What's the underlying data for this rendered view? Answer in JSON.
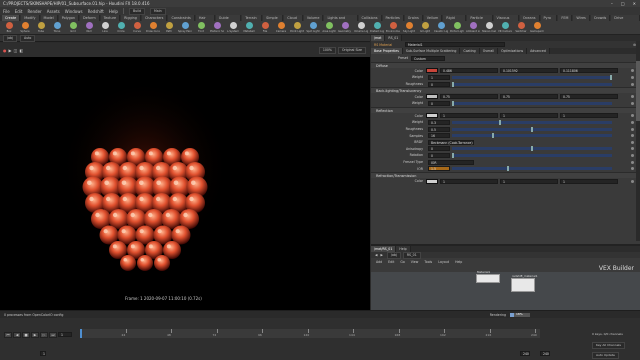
{
  "window": {
    "title": "C:/PROJECTS/SKINSHAPE/HIP/01_Subsurface.01.hip - Houdini FX 18.0.416",
    "buttons": [
      "–",
      "□",
      "✕"
    ]
  },
  "menu": [
    "File",
    "Edit",
    "Render",
    "Assets",
    "Windows",
    "Redshift",
    "Help",
    "Build",
    "Main"
  ],
  "shelf_tabs": [
    "Create",
    "Modify",
    "Model",
    "Polygon",
    "Deform",
    "Texture",
    "Rigging",
    "Characters",
    "Constraints",
    "Hair Utils",
    "Guide Process",
    "Terrain FX",
    "Simple FX",
    "Cloud FX",
    "Volume",
    "Lights and Cameras",
    "Collisions",
    "Particles",
    "Grains",
    "Vellum",
    "Rigid Bodies",
    "Particle Fluids",
    "Viscous Fluids",
    "Oceans",
    "Pyro FX",
    "FEM",
    "Wires",
    "Crowds",
    "Drive Simulation"
  ],
  "shelf_tools": [
    "Box",
    "Sphere",
    "Tube",
    "Torus",
    "Grid",
    "Null",
    "Line",
    "Circle",
    "Curve",
    "Draw Curve",
    "Path",
    "Spray Paint",
    "Font",
    "Platonic Solids",
    "L-System",
    "Metaball",
    "File",
    "Camera",
    "Point Light",
    "Spot Light",
    "Area Light",
    "Geometry Light",
    "Volume Light",
    "Distant Light",
    "Environment Light",
    "Sky Light",
    "GI Light",
    "Caustic Light",
    "Portal Light",
    "Ambient Light",
    "Stereo Camera",
    "VR Camera",
    "Switcher",
    "Gamepad Camera"
  ],
  "viewport": {
    "toolbar": [
      "/obj",
      "Auto"
    ],
    "zoom": "100%",
    "display": "Original Size",
    "frame_info": "Frame: 1   2020-09-07  11:00:10  (0.72s)"
  },
  "params": {
    "tabs": [
      "/mat",
      "RS_01"
    ],
    "node_type": "RS Material",
    "node_name": "Material1",
    "subtabs": [
      "Base Properties",
      "Sub-Surface Multiple Scattering",
      "Coating",
      "Overall",
      "Optimizations",
      "Advanced"
    ],
    "preset": {
      "label": "Preset",
      "value": "Custom"
    },
    "sections": [
      {
        "title": "Diffuse",
        "rows": [
          {
            "label": "Color",
            "swatch": "#c8453a",
            "values": [
              "0.486",
              "0.101592",
              "0.111806"
            ]
          },
          {
            "label": "Weight",
            "values": [
              "1"
            ],
            "slider": 1.0
          },
          {
            "label": "Roughness",
            "values": [
              "0"
            ],
            "slider": 0.0
          }
        ]
      },
      {
        "title": "Back-lighting/Translucency",
        "rows": [
          {
            "label": "Color",
            "swatch": "#bfbfbf",
            "values": [
              "0.75",
              "0.75",
              "0.75"
            ]
          },
          {
            "label": "Weight",
            "values": [
              "0"
            ],
            "slider": 0.0
          }
        ]
      },
      {
        "title": "Reflection",
        "rows": [
          {
            "label": "Color",
            "swatch": "#d0d0d0",
            "values": [
              "1",
              "1",
              "1"
            ]
          },
          {
            "label": "Weight",
            "values": [
              "0.3"
            ],
            "slider": 0.3
          },
          {
            "label": "Roughness",
            "values": [
              "0.5"
            ],
            "slider": 0.5
          },
          {
            "label": "Samples",
            "values": [
              "16"
            ],
            "slider": 0.25
          },
          {
            "label": "BRDF",
            "values": [
              "Beckmann (Cook-Torrance)"
            ]
          },
          {
            "label": "Anisotropy",
            "values": [
              "0"
            ],
            "slider": 0.5
          },
          {
            "label": "Rotation",
            "values": [
              "0"
            ],
            "slider": 0.0
          },
          {
            "label": "Fresnel Type",
            "values": [
              "IOR"
            ]
          },
          {
            "label": "IOR",
            "values": [
              "1.5"
            ],
            "slider": 0.35
          }
        ]
      },
      {
        "title": "Refraction/Transmission",
        "rows": [
          {
            "label": "Color",
            "swatch": "#d0d0d0",
            "values": [
              "1",
              "1",
              "1"
            ]
          }
        ]
      }
    ]
  },
  "network": {
    "tabs": [
      "/mat/RS_01",
      "Help"
    ],
    "menu": [
      "Add",
      "Edit",
      "Go",
      "View",
      "Tools",
      "Layout",
      "Help"
    ],
    "path": [
      "/obj",
      "RS_01"
    ],
    "builder": "VEX Builder",
    "nodes": [
      "Material1",
      "redshift_material1"
    ]
  },
  "timeline": {
    "status": "0 processes from OpenColorIO config",
    "rendering": "Rendering",
    "progress": "18%",
    "frame": "1",
    "start": "1",
    "end": "240",
    "end2": "240",
    "ticks": [
      "24",
      "48",
      "72",
      "96",
      "120",
      "144",
      "168",
      "192",
      "216",
      "240"
    ],
    "keys": "0 keys, 0/0 channels",
    "key_all": "Key All Channels",
    "auto_update": "Auto Update"
  }
}
